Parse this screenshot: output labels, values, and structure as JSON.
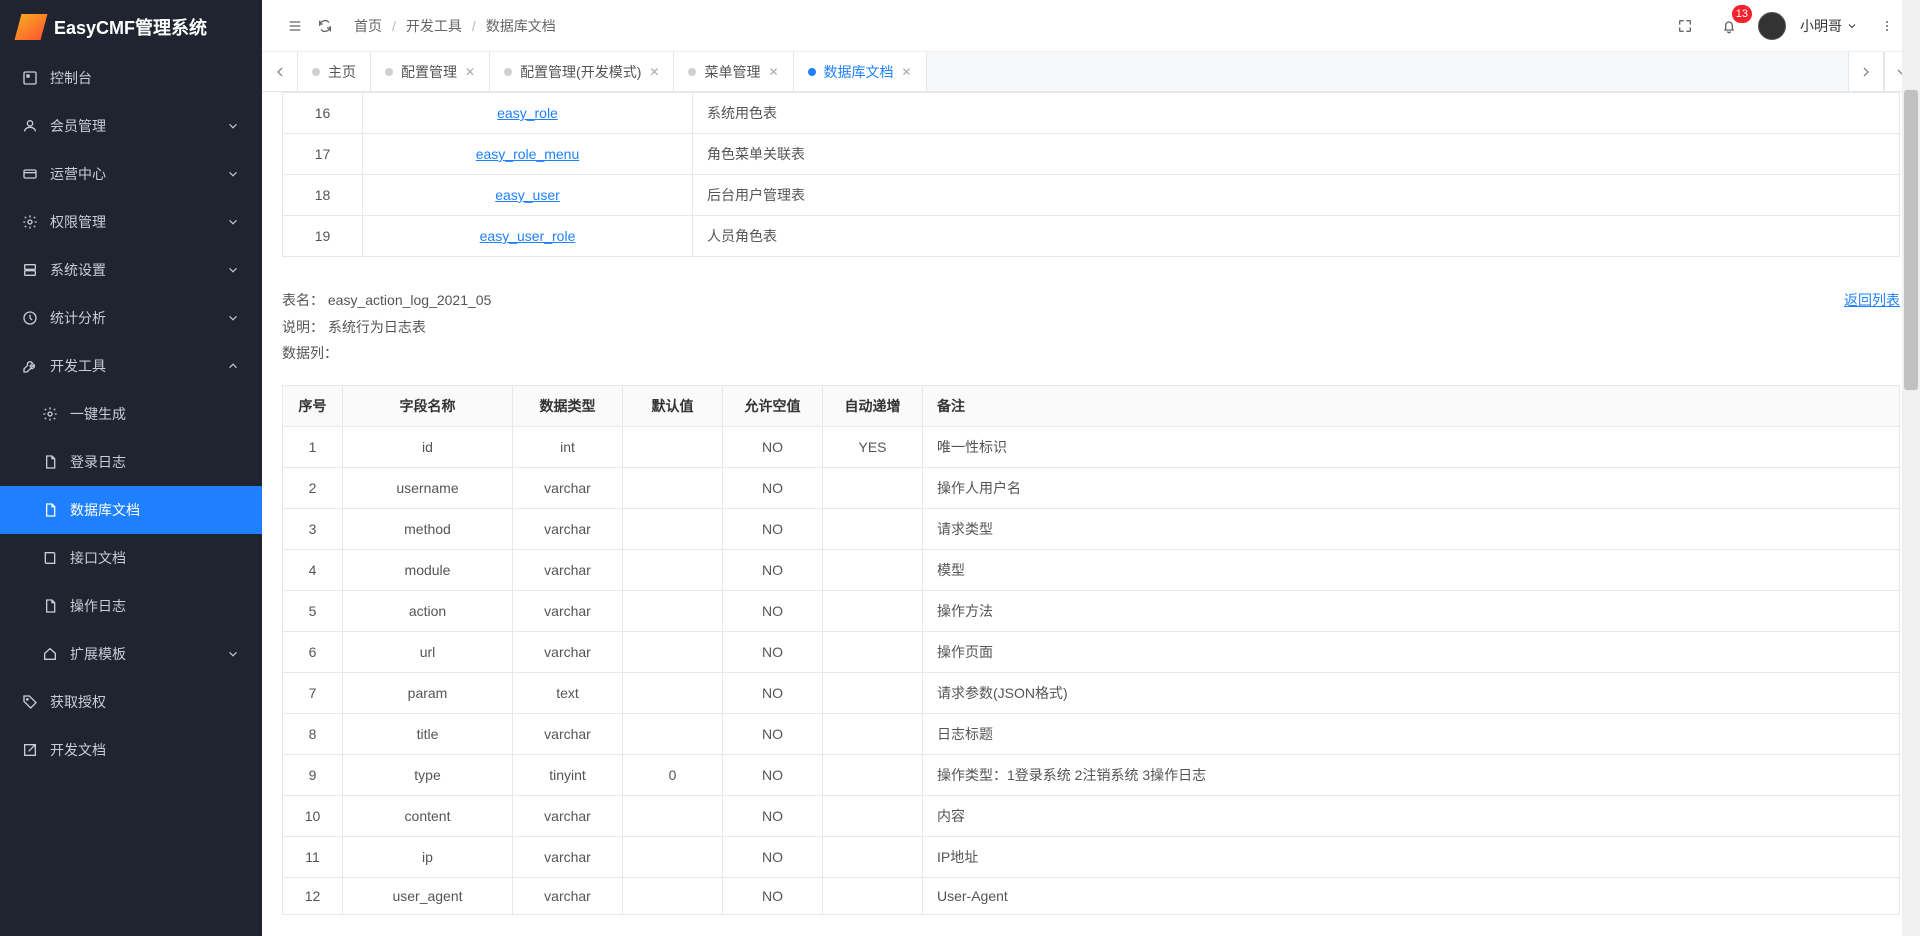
{
  "app_title": "EasyCMF管理系统",
  "badge_count": "13",
  "user_name": "小明哥",
  "breadcrumb": [
    "首页",
    "开发工具",
    "数据库文档"
  ],
  "sidebar": {
    "items": [
      {
        "label": "控制台",
        "icon": "dashboard-icon",
        "chev": null
      },
      {
        "label": "会员管理",
        "icon": "users-icon",
        "chev": "down"
      },
      {
        "label": "运营中心",
        "icon": "card-icon",
        "chev": "down"
      },
      {
        "label": "权限管理",
        "icon": "gear-icon",
        "chev": "down"
      },
      {
        "label": "系统设置",
        "icon": "server-icon",
        "chev": "down"
      },
      {
        "label": "统计分析",
        "icon": "clock-icon",
        "chev": "down"
      },
      {
        "label": "开发工具",
        "icon": "wrench-icon",
        "chev": "up"
      },
      {
        "label": "一键生成",
        "icon": "gear-icon",
        "sub": true
      },
      {
        "label": "登录日志",
        "icon": "doc-icon",
        "sub": true
      },
      {
        "label": "数据库文档",
        "icon": "doc-icon",
        "sub": true,
        "active": true
      },
      {
        "label": "接口文档",
        "icon": "book-icon",
        "sub": true
      },
      {
        "label": "操作日志",
        "icon": "doc-icon",
        "sub": true
      },
      {
        "label": "扩展模板",
        "icon": "home-icon",
        "sub": true,
        "chev": "down"
      },
      {
        "label": "获取授权",
        "icon": "tag-icon"
      },
      {
        "label": "开发文档",
        "icon": "external-icon"
      }
    ]
  },
  "tabs": [
    {
      "label": "主页",
      "closable": false
    },
    {
      "label": "配置管理",
      "closable": true
    },
    {
      "label": "配置管理(开发模式)",
      "closable": true
    },
    {
      "label": "菜单管理",
      "closable": true
    },
    {
      "label": "数据库文档",
      "closable": true,
      "active": true
    }
  ],
  "top_table": {
    "rows": [
      {
        "n": "16",
        "name": "easy_role",
        "desc": "系统用色表"
      },
      {
        "n": "17",
        "name": "easy_role_menu",
        "desc": "角色菜单关联表"
      },
      {
        "n": "18",
        "name": "easy_user",
        "desc": "后台用户管理表"
      },
      {
        "n": "19",
        "name": "easy_user_role",
        "desc": "人员角色表"
      }
    ]
  },
  "info": {
    "table_name_label": "表名：",
    "table_name": "easy_action_log_2021_05",
    "desc_label": "说明：",
    "desc": "系统行为日志表",
    "cols_label": "数据列：",
    "back_label": "返回列表"
  },
  "col_table": {
    "headers": [
      "序号",
      "字段名称",
      "数据类型",
      "默认值",
      "允许空值",
      "自动递增",
      "备注"
    ],
    "rows": [
      {
        "n": "1",
        "field": "id",
        "type": "int",
        "def": "",
        "null": "NO",
        "ai": "YES",
        "remark": "唯一性标识"
      },
      {
        "n": "2",
        "field": "username",
        "type": "varchar",
        "def": "",
        "null": "NO",
        "ai": "",
        "remark": "操作人用户名"
      },
      {
        "n": "3",
        "field": "method",
        "type": "varchar",
        "def": "",
        "null": "NO",
        "ai": "",
        "remark": "请求类型"
      },
      {
        "n": "4",
        "field": "module",
        "type": "varchar",
        "def": "",
        "null": "NO",
        "ai": "",
        "remark": "模型"
      },
      {
        "n": "5",
        "field": "action",
        "type": "varchar",
        "def": "",
        "null": "NO",
        "ai": "",
        "remark": "操作方法"
      },
      {
        "n": "6",
        "field": "url",
        "type": "varchar",
        "def": "",
        "null": "NO",
        "ai": "",
        "remark": "操作页面"
      },
      {
        "n": "7",
        "field": "param",
        "type": "text",
        "def": "",
        "null": "NO",
        "ai": "",
        "remark": "请求参数(JSON格式)"
      },
      {
        "n": "8",
        "field": "title",
        "type": "varchar",
        "def": "",
        "null": "NO",
        "ai": "",
        "remark": "日志标题"
      },
      {
        "n": "9",
        "field": "type",
        "type": "tinyint",
        "def": "0",
        "null": "NO",
        "ai": "",
        "remark": "操作类型：1登录系统 2注销系统 3操作日志"
      },
      {
        "n": "10",
        "field": "content",
        "type": "varchar",
        "def": "",
        "null": "NO",
        "ai": "",
        "remark": "内容"
      },
      {
        "n": "11",
        "field": "ip",
        "type": "varchar",
        "def": "",
        "null": "NO",
        "ai": "",
        "remark": "IP地址"
      },
      {
        "n": "12",
        "field": "user_agent",
        "type": "varchar",
        "def": "",
        "null": "NO",
        "ai": "",
        "remark": "User-Agent"
      }
    ]
  }
}
